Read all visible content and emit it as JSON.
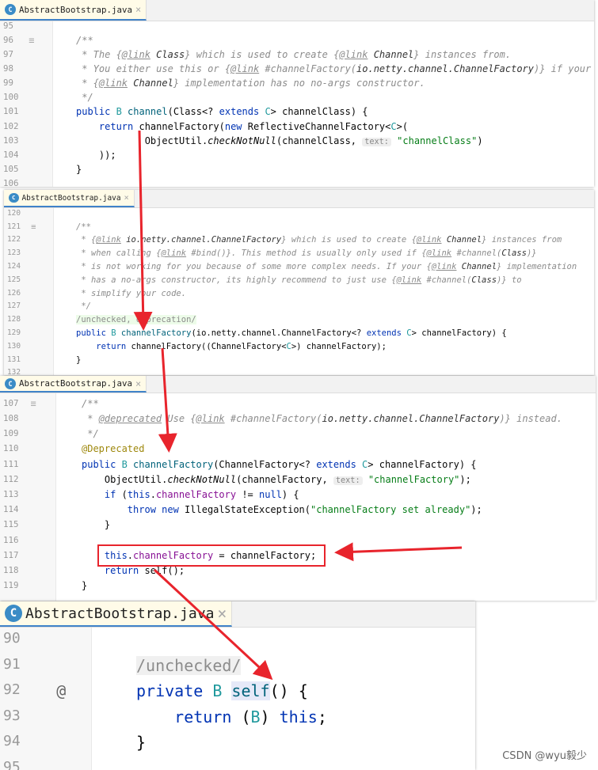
{
  "panels": [
    {
      "tab": "AbstractBootstrap.java",
      "lines": [
        {
          "n": "95",
          "t": []
        },
        {
          "n": "96",
          "mark": "doc",
          "t": [
            [
              "/**",
              "c"
            ]
          ]
        },
        {
          "n": "97",
          "t": [
            [
              " * The {",
              "c"
            ],
            [
              "@link",
              "ct"
            ],
            [
              " Class",
              "cb"
            ],
            [
              "} which is used to create {",
              "c"
            ],
            [
              "@link",
              "ct"
            ],
            [
              " Channel",
              "cb"
            ],
            [
              "} instances from.",
              "c"
            ]
          ]
        },
        {
          "n": "98",
          "t": [
            [
              " * You either use this or {",
              "c"
            ],
            [
              "@link",
              "ct"
            ],
            [
              " #channelFactory(",
              "c"
            ],
            [
              "io.netty.channel.ChannelFactory",
              "cb"
            ],
            [
              ")} if your",
              "c"
            ]
          ]
        },
        {
          "n": "99",
          "t": [
            [
              " * {",
              "c"
            ],
            [
              "@link",
              "ct"
            ],
            [
              " Channel",
              "cb"
            ],
            [
              "} implementation has no no-args constructor.",
              "c"
            ]
          ]
        },
        {
          "n": "100",
          "t": [
            [
              " */",
              "c"
            ]
          ]
        },
        {
          "n": "101",
          "t": [
            [
              "public ",
              "k"
            ],
            [
              "B ",
              "t"
            ],
            [
              "channel",
              "m"
            ],
            [
              "(Class<? ",
              "p"
            ],
            [
              "extends ",
              "k"
            ],
            [
              "C",
              "t"
            ],
            [
              "> channelClass) {",
              "p"
            ]
          ]
        },
        {
          "n": "102",
          "t": [
            [
              "    return ",
              "k"
            ],
            [
              "channelFactory(",
              "p"
            ],
            [
              "new ",
              "k"
            ],
            [
              "ReflectiveChannelFactory<",
              "p"
            ],
            [
              "C",
              "t"
            ],
            [
              ">(",
              "p"
            ]
          ]
        },
        {
          "n": "103",
          "t": [
            [
              "            ObjectUtil.",
              "p"
            ],
            [
              "checkNotNull",
              "st"
            ],
            [
              "(channelClass, ",
              "p"
            ],
            [
              "text:",
              "h"
            ],
            [
              " ",
              "p"
            ],
            [
              "\"channelClass\"",
              "s"
            ],
            [
              ")",
              "p"
            ]
          ]
        },
        {
          "n": "104",
          "t": [
            [
              "    ));",
              "p"
            ]
          ]
        },
        {
          "n": "105",
          "t": [
            [
              "}",
              "p"
            ]
          ]
        },
        {
          "n": "106",
          "t": []
        }
      ]
    },
    {
      "tab": "AbstractBootstrap.java",
      "lines": [
        {
          "n": "120",
          "t": []
        },
        {
          "n": "121",
          "mark": "doc",
          "t": [
            [
              "/**",
              "c"
            ]
          ]
        },
        {
          "n": "122",
          "t": [
            [
              " * {",
              "c"
            ],
            [
              "@link",
              "ct"
            ],
            [
              " io.netty.channel.ChannelFactory",
              "cb"
            ],
            [
              "} which is used to create {",
              "c"
            ],
            [
              "@link",
              "ct"
            ],
            [
              " Channel",
              "cb"
            ],
            [
              "} instances from",
              "c"
            ]
          ]
        },
        {
          "n": "123",
          "t": [
            [
              " * when calling {",
              "c"
            ],
            [
              "@link",
              "ct"
            ],
            [
              " #bind()}. This method is usually only used if {",
              "c"
            ],
            [
              "@link",
              "ct"
            ],
            [
              " #channel(",
              "c"
            ],
            [
              "Class",
              "cb"
            ],
            [
              ")}",
              "c"
            ]
          ]
        },
        {
          "n": "124",
          "t": [
            [
              " * is not working for you because of some more complex needs. If your {",
              "c"
            ],
            [
              "@link",
              "ct"
            ],
            [
              " Channel",
              "cb"
            ],
            [
              "} implementation",
              "c"
            ]
          ]
        },
        {
          "n": "125",
          "t": [
            [
              " * has a no-args constructor, its highly recommend to just use {",
              "c"
            ],
            [
              "@link",
              "ct"
            ],
            [
              " #channel(",
              "c"
            ],
            [
              "Class",
              "cb"
            ],
            [
              ")} to",
              "c"
            ]
          ]
        },
        {
          "n": "126",
          "t": [
            [
              " * simplify your code.",
              "c"
            ]
          ]
        },
        {
          "n": "127",
          "t": [
            [
              " */",
              "c"
            ]
          ]
        },
        {
          "n": "128",
          "t": [
            [
              "/unchecked, deprecation/",
              "sup"
            ]
          ]
        },
        {
          "n": "129",
          "t": [
            [
              "public ",
              "k"
            ],
            [
              "B ",
              "t"
            ],
            [
              "channelFactory",
              "m"
            ],
            [
              "(io.netty.channel.ChannelFactory<? ",
              "p"
            ],
            [
              "extends ",
              "k"
            ],
            [
              "C",
              "t"
            ],
            [
              "> channelFactory) {",
              "p"
            ]
          ]
        },
        {
          "n": "130",
          "t": [
            [
              "    return ",
              "k"
            ],
            [
              "channelFactory((ChannelFactory<",
              "p"
            ],
            [
              "C",
              "t"
            ],
            [
              ">) channelFactory);",
              "p"
            ]
          ]
        },
        {
          "n": "131",
          "t": [
            [
              "}",
              "p"
            ]
          ]
        },
        {
          "n": "132",
          "t": []
        }
      ]
    },
    {
      "tab": "AbstractBootstrap.java",
      "lines": [
        {
          "n": "107",
          "mark": "doc",
          "t": [
            [
              "/**",
              "c"
            ]
          ]
        },
        {
          "n": "108",
          "t": [
            [
              " * ",
              "c"
            ],
            [
              "@deprecated",
              "ct"
            ],
            [
              " Use {",
              "c"
            ],
            [
              "@link",
              "ct"
            ],
            [
              " #channelFactory(",
              "c"
            ],
            [
              "io.netty.channel.ChannelFactory",
              "cb"
            ],
            [
              ")} instead.",
              "c"
            ]
          ]
        },
        {
          "n": "109",
          "t": [
            [
              " */",
              "c"
            ]
          ]
        },
        {
          "n": "110",
          "t": [
            [
              "@Deprecated",
              "a"
            ]
          ]
        },
        {
          "n": "111",
          "t": [
            [
              "public ",
              "k"
            ],
            [
              "B ",
              "t"
            ],
            [
              "channelFactory",
              "m"
            ],
            [
              "(ChannelFactory<? ",
              "p"
            ],
            [
              "extends ",
              "k"
            ],
            [
              "C",
              "t"
            ],
            [
              "> channelFactory) {",
              "p"
            ]
          ]
        },
        {
          "n": "112",
          "t": [
            [
              "    ObjectUtil.",
              "p"
            ],
            [
              "checkNotNull",
              "st"
            ],
            [
              "(channelFactory, ",
              "p"
            ],
            [
              "text:",
              "h"
            ],
            [
              " ",
              "p"
            ],
            [
              "\"channelFactory\"",
              "s"
            ],
            [
              ");",
              "p"
            ]
          ]
        },
        {
          "n": "113",
          "t": [
            [
              "    if ",
              "k"
            ],
            [
              "(",
              "p"
            ],
            [
              "this",
              "k"
            ],
            [
              ".",
              "p"
            ],
            [
              "channelFactory",
              "f"
            ],
            [
              " != ",
              "p"
            ],
            [
              "null",
              "k"
            ],
            [
              ") {",
              "p"
            ]
          ]
        },
        {
          "n": "114",
          "t": [
            [
              "        throw new ",
              "k"
            ],
            [
              "IllegalStateException(",
              "p"
            ],
            [
              "\"channelFactory set already\"",
              "s"
            ],
            [
              ");",
              "p"
            ]
          ]
        },
        {
          "n": "115",
          "t": [
            [
              "    }",
              "p"
            ]
          ]
        },
        {
          "n": "116",
          "t": []
        },
        {
          "n": "117",
          "t": [
            [
              "    this",
              "k"
            ],
            [
              ".",
              "p"
            ],
            [
              "channelFactory",
              "f"
            ],
            [
              " = channelFactory;",
              "p"
            ]
          ]
        },
        {
          "n": "118",
          "t": [
            [
              "    return ",
              "k"
            ],
            [
              "self();",
              "p"
            ]
          ]
        },
        {
          "n": "119",
          "t": [
            [
              "}",
              "p"
            ]
          ]
        }
      ]
    },
    {
      "tab": "AbstractBootstrap.java",
      "lines": [
        {
          "n": "90",
          "t": []
        },
        {
          "n": "91",
          "t": [
            [
              "/unchecked/",
              "sup4"
            ]
          ]
        },
        {
          "n": "92",
          "mark": "@",
          "t": [
            [
              "private ",
              "k"
            ],
            [
              "B ",
              "t"
            ],
            [
              "self",
              "m hl"
            ],
            [
              "() {",
              "p"
            ]
          ]
        },
        {
          "n": "93",
          "t": [
            [
              "    return ",
              "k"
            ],
            [
              "(",
              "p"
            ],
            [
              "B",
              "t"
            ],
            [
              ") ",
              "p"
            ],
            [
              "this",
              "k"
            ],
            [
              ";",
              "p"
            ]
          ]
        },
        {
          "n": "94",
          "t": [
            [
              "}",
              "p"
            ]
          ]
        },
        {
          "n": "95",
          "t": []
        }
      ]
    }
  ],
  "watermark": "CSDN @wyu毅少",
  "colors": {
    "arrow": "#e8242c",
    "keyword": "#0033b3",
    "string": "#067d17",
    "comment": "#8c8c8c"
  }
}
